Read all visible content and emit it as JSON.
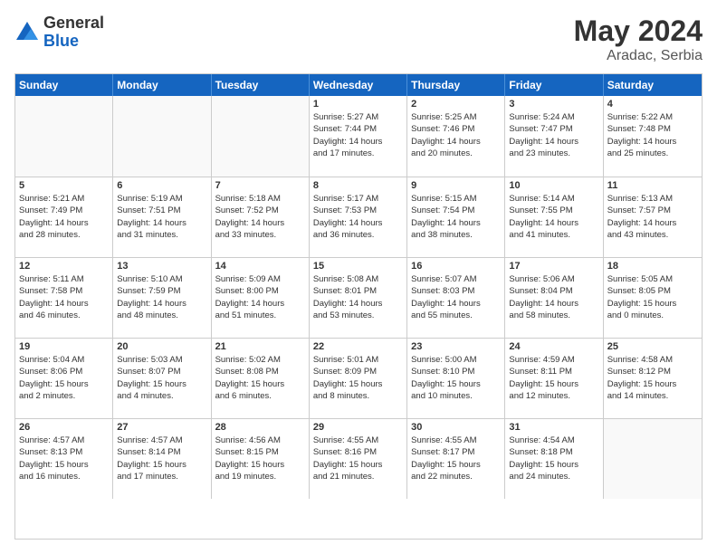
{
  "logo": {
    "general": "General",
    "blue": "Blue"
  },
  "header": {
    "month_year": "May 2024",
    "location": "Aradac, Serbia"
  },
  "weekdays": [
    "Sunday",
    "Monday",
    "Tuesday",
    "Wednesday",
    "Thursday",
    "Friday",
    "Saturday"
  ],
  "rows": [
    [
      {
        "day": "",
        "info": ""
      },
      {
        "day": "",
        "info": ""
      },
      {
        "day": "",
        "info": ""
      },
      {
        "day": "1",
        "info": "Sunrise: 5:27 AM\nSunset: 7:44 PM\nDaylight: 14 hours\nand 17 minutes."
      },
      {
        "day": "2",
        "info": "Sunrise: 5:25 AM\nSunset: 7:46 PM\nDaylight: 14 hours\nand 20 minutes."
      },
      {
        "day": "3",
        "info": "Sunrise: 5:24 AM\nSunset: 7:47 PM\nDaylight: 14 hours\nand 23 minutes."
      },
      {
        "day": "4",
        "info": "Sunrise: 5:22 AM\nSunset: 7:48 PM\nDaylight: 14 hours\nand 25 minutes."
      }
    ],
    [
      {
        "day": "5",
        "info": "Sunrise: 5:21 AM\nSunset: 7:49 PM\nDaylight: 14 hours\nand 28 minutes."
      },
      {
        "day": "6",
        "info": "Sunrise: 5:19 AM\nSunset: 7:51 PM\nDaylight: 14 hours\nand 31 minutes."
      },
      {
        "day": "7",
        "info": "Sunrise: 5:18 AM\nSunset: 7:52 PM\nDaylight: 14 hours\nand 33 minutes."
      },
      {
        "day": "8",
        "info": "Sunrise: 5:17 AM\nSunset: 7:53 PM\nDaylight: 14 hours\nand 36 minutes."
      },
      {
        "day": "9",
        "info": "Sunrise: 5:15 AM\nSunset: 7:54 PM\nDaylight: 14 hours\nand 38 minutes."
      },
      {
        "day": "10",
        "info": "Sunrise: 5:14 AM\nSunset: 7:55 PM\nDaylight: 14 hours\nand 41 minutes."
      },
      {
        "day": "11",
        "info": "Sunrise: 5:13 AM\nSunset: 7:57 PM\nDaylight: 14 hours\nand 43 minutes."
      }
    ],
    [
      {
        "day": "12",
        "info": "Sunrise: 5:11 AM\nSunset: 7:58 PM\nDaylight: 14 hours\nand 46 minutes."
      },
      {
        "day": "13",
        "info": "Sunrise: 5:10 AM\nSunset: 7:59 PM\nDaylight: 14 hours\nand 48 minutes."
      },
      {
        "day": "14",
        "info": "Sunrise: 5:09 AM\nSunset: 8:00 PM\nDaylight: 14 hours\nand 51 minutes."
      },
      {
        "day": "15",
        "info": "Sunrise: 5:08 AM\nSunset: 8:01 PM\nDaylight: 14 hours\nand 53 minutes."
      },
      {
        "day": "16",
        "info": "Sunrise: 5:07 AM\nSunset: 8:03 PM\nDaylight: 14 hours\nand 55 minutes."
      },
      {
        "day": "17",
        "info": "Sunrise: 5:06 AM\nSunset: 8:04 PM\nDaylight: 14 hours\nand 58 minutes."
      },
      {
        "day": "18",
        "info": "Sunrise: 5:05 AM\nSunset: 8:05 PM\nDaylight: 15 hours\nand 0 minutes."
      }
    ],
    [
      {
        "day": "19",
        "info": "Sunrise: 5:04 AM\nSunset: 8:06 PM\nDaylight: 15 hours\nand 2 minutes."
      },
      {
        "day": "20",
        "info": "Sunrise: 5:03 AM\nSunset: 8:07 PM\nDaylight: 15 hours\nand 4 minutes."
      },
      {
        "day": "21",
        "info": "Sunrise: 5:02 AM\nSunset: 8:08 PM\nDaylight: 15 hours\nand 6 minutes."
      },
      {
        "day": "22",
        "info": "Sunrise: 5:01 AM\nSunset: 8:09 PM\nDaylight: 15 hours\nand 8 minutes."
      },
      {
        "day": "23",
        "info": "Sunrise: 5:00 AM\nSunset: 8:10 PM\nDaylight: 15 hours\nand 10 minutes."
      },
      {
        "day": "24",
        "info": "Sunrise: 4:59 AM\nSunset: 8:11 PM\nDaylight: 15 hours\nand 12 minutes."
      },
      {
        "day": "25",
        "info": "Sunrise: 4:58 AM\nSunset: 8:12 PM\nDaylight: 15 hours\nand 14 minutes."
      }
    ],
    [
      {
        "day": "26",
        "info": "Sunrise: 4:57 AM\nSunset: 8:13 PM\nDaylight: 15 hours\nand 16 minutes."
      },
      {
        "day": "27",
        "info": "Sunrise: 4:57 AM\nSunset: 8:14 PM\nDaylight: 15 hours\nand 17 minutes."
      },
      {
        "day": "28",
        "info": "Sunrise: 4:56 AM\nSunset: 8:15 PM\nDaylight: 15 hours\nand 19 minutes."
      },
      {
        "day": "29",
        "info": "Sunrise: 4:55 AM\nSunset: 8:16 PM\nDaylight: 15 hours\nand 21 minutes."
      },
      {
        "day": "30",
        "info": "Sunrise: 4:55 AM\nSunset: 8:17 PM\nDaylight: 15 hours\nand 22 minutes."
      },
      {
        "day": "31",
        "info": "Sunrise: 4:54 AM\nSunset: 8:18 PM\nDaylight: 15 hours\nand 24 minutes."
      },
      {
        "day": "",
        "info": ""
      }
    ]
  ]
}
